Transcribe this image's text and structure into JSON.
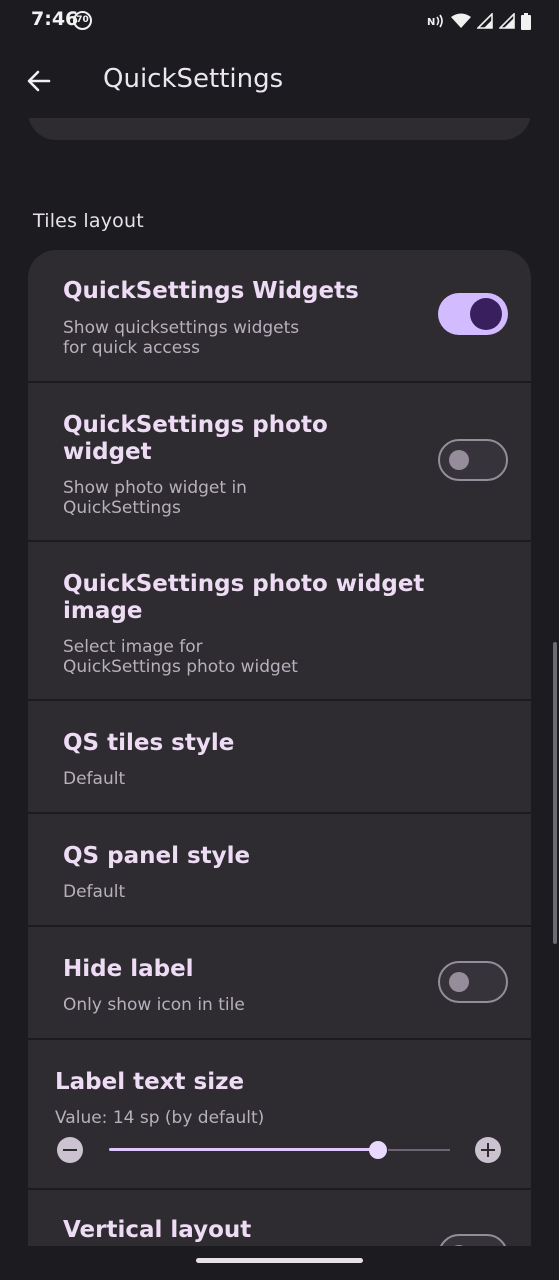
{
  "status_bar": {
    "time": "7:46",
    "notification_badge": "70",
    "icons": [
      "nfc-icon",
      "wifi-icon",
      "signal-icon",
      "signal-icon",
      "battery-icon"
    ]
  },
  "app_bar": {
    "title": "QuickSettings",
    "back_icon": "arrow-left-icon"
  },
  "section": {
    "title": "Tiles layout"
  },
  "items": [
    {
      "title": "QuickSettings Widgets",
      "subtitle": "Show quicksettings widgets\nfor quick access",
      "toggle": "on"
    },
    {
      "title": "QuickSettings photo\nwidget",
      "subtitle": "Show photo widget in\nQuickSettings",
      "toggle": "off"
    },
    {
      "title": "QuickSettings photo widget\nimage",
      "subtitle": "Select image for\nQuickSettings photo widget"
    },
    {
      "title": "QS tiles style",
      "subtitle": "Default"
    },
    {
      "title": "QS panel style",
      "subtitle": "Default"
    },
    {
      "title": "Hide label",
      "subtitle": "Only show icon in tile",
      "toggle": "off"
    }
  ],
  "slider": {
    "title": "Label text size",
    "value_text": "Value: 14 sp (by default)",
    "level": 0.79,
    "minus_icon": "minus-circle-icon",
    "plus_icon": "plus-circle-icon"
  },
  "partial_item": {
    "title": "Vertical layout",
    "toggle": "off"
  },
  "colors": {
    "background": "#1c1b1f",
    "card": "#2e2b31",
    "toggle_on": "#d2bcff",
    "accent_title": "#eedbf4"
  }
}
